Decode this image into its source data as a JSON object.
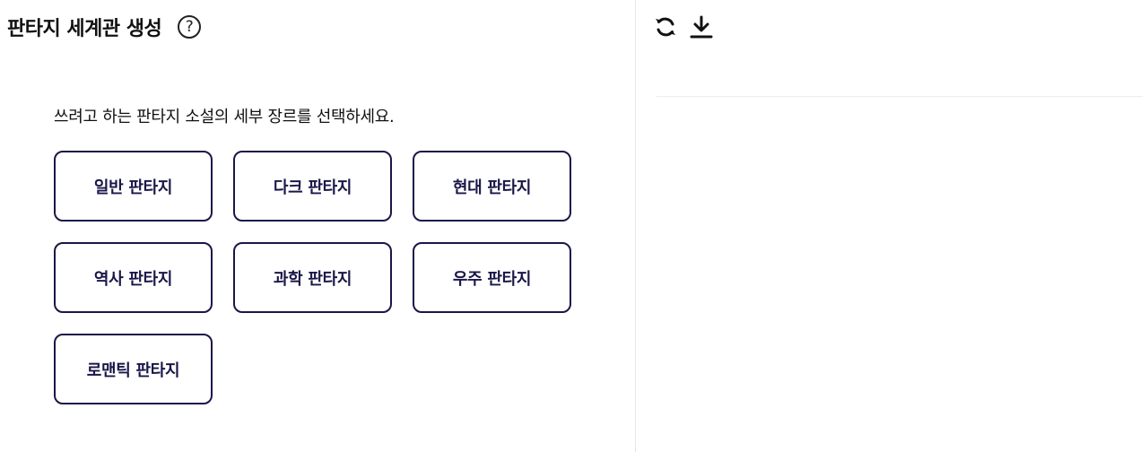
{
  "header": {
    "title": "판타지 세계관 생성",
    "help_symbol": "?"
  },
  "main": {
    "prompt": "쓰려고 하는 판타지 소설의 세부 장르를 선택하세요.",
    "genres": [
      "일반 판타지",
      "다크 판타지",
      "현대 판타지",
      "역사 판타지",
      "과학 판타지",
      "우주 판타지",
      "로맨틱 판타지"
    ]
  },
  "toolbar": {
    "icons": [
      "refresh-icon",
      "download-icon"
    ]
  },
  "colors": {
    "button_border": "#1a1748",
    "button_text": "#1a1748",
    "title": "#111111",
    "divider": "#ececf0"
  }
}
